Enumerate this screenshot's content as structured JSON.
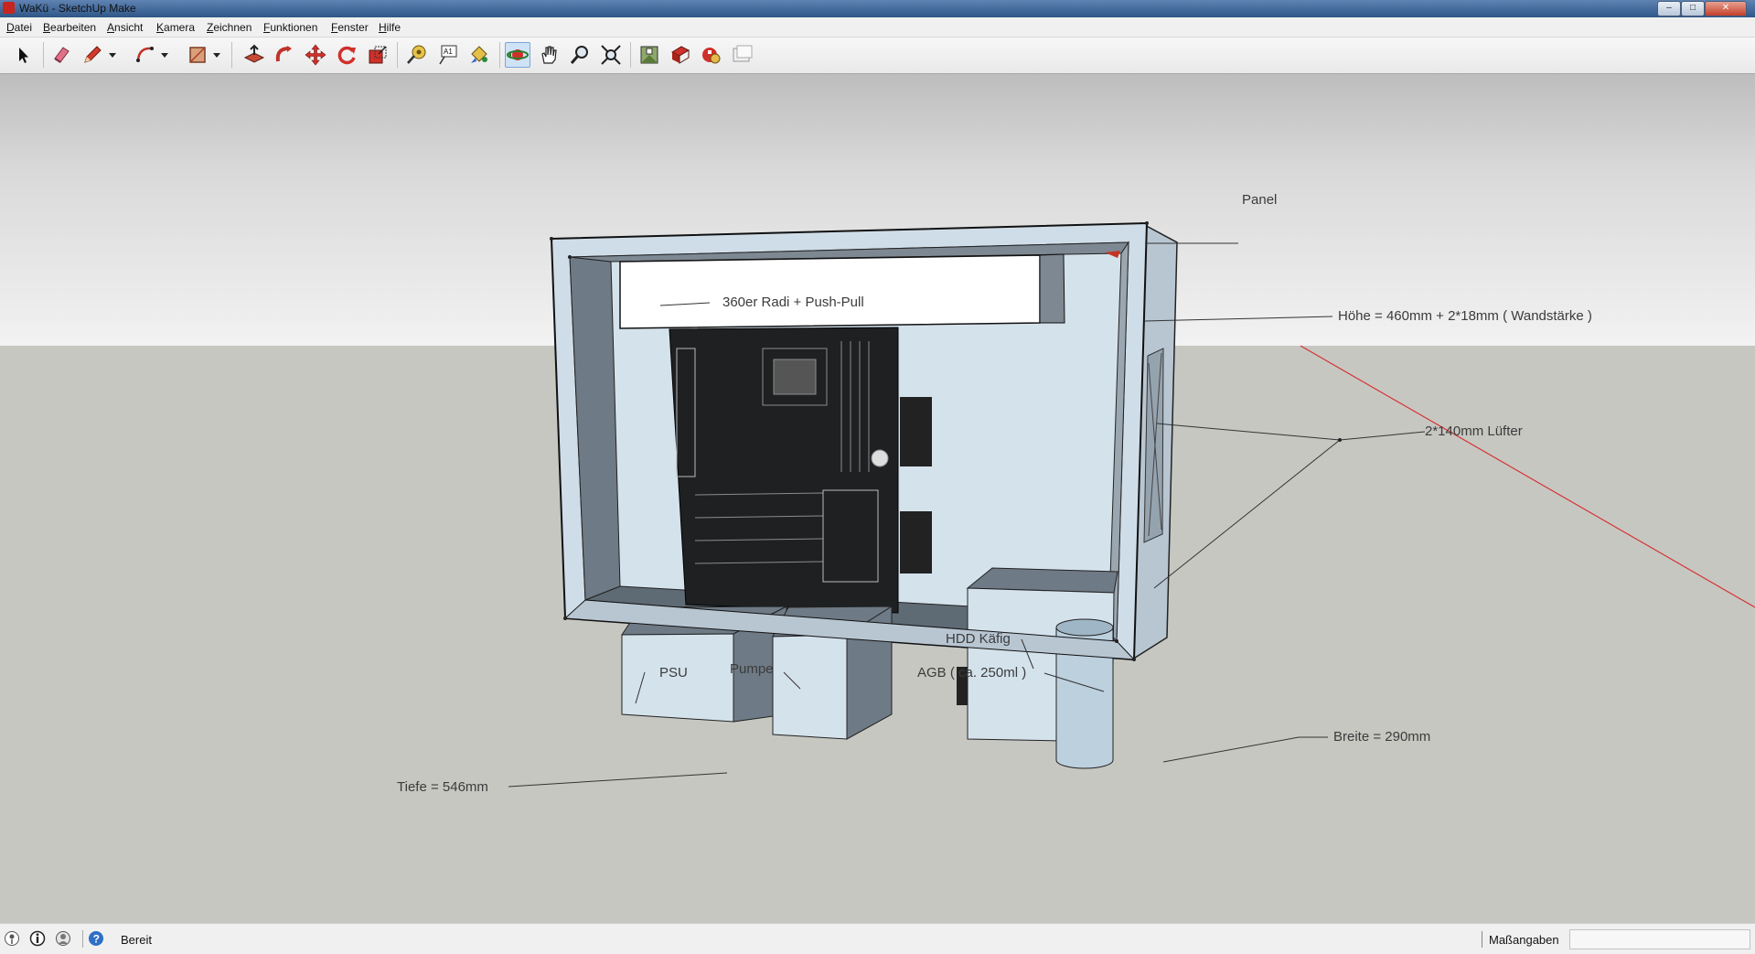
{
  "window": {
    "title": "WaKü - SketchUp Make",
    "controls": {
      "minimize": "–",
      "maximize": "□",
      "close": "✕"
    }
  },
  "menu": [
    "Datei",
    "Bearbeiten",
    "Ansicht",
    "Kamera",
    "Zeichnen",
    "Funktionen",
    "Fenster",
    "Hilfe"
  ],
  "toolbar": {
    "tools": [
      "select-icon",
      "eraser-icon",
      "pencil-icon",
      "dropdown-icon",
      "arc-icon",
      "dropdown-icon",
      "rectangle-icon",
      "dropdown-icon",
      "push-pull-icon",
      "follow-me-icon",
      "move-icon",
      "rotate-icon",
      "scale-icon",
      "tape-measure-icon",
      "text-icon",
      "paint-bucket-icon",
      "orbit-icon",
      "pan-icon",
      "zoom-icon",
      "zoom-extents-icon",
      "warehouse-icon",
      "share-model-icon",
      "extension-warehouse-icon",
      "layout-icon"
    ],
    "active_tool": "orbit-icon"
  },
  "annotations": {
    "panel": "Panel",
    "radiator": "360er Radi + Push-Pull",
    "height": "Höhe = 460mm + 2*18mm ( Wandstärke )",
    "fans": "2*140mm Lüfter",
    "hdd": "HDD Käfig",
    "reservoir": "AGB ( ca. 250ml )",
    "psu": "PSU",
    "pump": "Pumpe",
    "depth": "Tiefe = 546mm",
    "width": "Breite = 290mm"
  },
  "status": {
    "text": "Bereit",
    "measurements_label": "Maßangaben",
    "measurements_value": ""
  },
  "colors": {
    "axis_red": "#d43535",
    "case_face": "#cfdde8",
    "case_interior": "#6e7a85"
  }
}
